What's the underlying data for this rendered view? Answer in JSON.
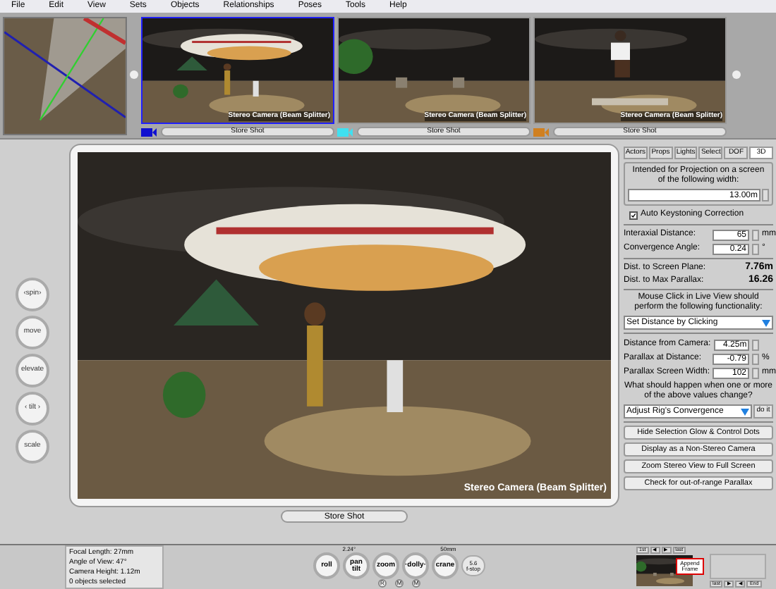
{
  "menu": [
    "File",
    "Edit",
    "View",
    "Sets",
    "Objects",
    "Relationships",
    "Poses",
    "Tools",
    "Help"
  ],
  "thumbnails": [
    {
      "caption": "Stereo Camera (Beam Splitter)",
      "button": "Store Shot",
      "selected": true,
      "color": "#1010d0"
    },
    {
      "caption": "Stereo Camera (Beam Splitter)",
      "button": "Store Shot",
      "selected": false,
      "color": "#40e0f0"
    },
    {
      "caption": "Stereo Camera (Beam Splitter)",
      "button": "Store Shot",
      "selected": false,
      "color": "#d08020"
    }
  ],
  "viewport": {
    "caption": "Stereo Camera (Beam Splitter)",
    "button": "Store Shot"
  },
  "left_controls": [
    {
      "label": "‹spin›"
    },
    {
      "label": "move"
    },
    {
      "label": "elevate"
    },
    {
      "label": "‹ tilt ›"
    },
    {
      "label": "scale"
    }
  ],
  "right_panel": {
    "tabs": [
      {
        "label": "Actors",
        "selected": false
      },
      {
        "label": "Props",
        "selected": false
      },
      {
        "label": "Lights",
        "selected": false
      },
      {
        "label": "Select",
        "selected": false
      },
      {
        "label": "DOF",
        "selected": false
      },
      {
        "label": "3D",
        "selected": true
      }
    ],
    "projection_label": "Intended for Projection on a screen of the following width:",
    "projection_width": "13.00m",
    "keystone": {
      "label": "Auto Keystoning Correction",
      "checked": true
    },
    "fields_a": [
      {
        "label": "Interaxial Distance:",
        "value": "65",
        "unit": "mm"
      },
      {
        "label": "Convergence Angle:",
        "value": "0.24",
        "unit": "°"
      }
    ],
    "readouts": [
      {
        "label": "Dist. to Screen Plane:",
        "value": "7.76m"
      },
      {
        "label": "Dist. to Max Parallax:",
        "value": "16.26"
      }
    ],
    "mouse_label": "Mouse Click in Live View should perform the following functionality:",
    "mouse_select": "Set Distance by Clicking",
    "fields_b": [
      {
        "label": "Distance from Camera:",
        "value": "4.25m"
      },
      {
        "label": "Parallax at Distance:",
        "value": "-0.79",
        "unit": "%"
      },
      {
        "label": "Parallax Screen Width:",
        "value": "102",
        "unit": "mm"
      }
    ],
    "change_label": "What should happen when one or more of the above values change?",
    "change_select": "Adjust Rig's Convergence",
    "do_it": "do it",
    "buttons": [
      "Hide Selection Glow & Control Dots",
      "Display as a Non-Stereo Camera",
      "Zoom Stereo View to Full Screen",
      "Check for out-of-range Parallax"
    ]
  },
  "info": [
    "Focal Length: 27mm",
    "Angle of View: 47°",
    "Camera Height: 1.12m",
    "0 objects selected"
  ],
  "dial": {
    "top_left": "2.24°",
    "top_right": "50mm",
    "controls": [
      "roll",
      "pan tilt",
      "zoom",
      "·dolly·",
      "crane"
    ],
    "fstop": "5.6",
    "fstop_label": "f-stop",
    "small_keys": [
      "R",
      "M",
      "M"
    ]
  },
  "timeline": {
    "nav": [
      "1st",
      "◀",
      "▶",
      "last"
    ],
    "tooltip": "Append Frame",
    "nav2": [
      "last",
      "▶",
      "◀",
      "End"
    ]
  }
}
